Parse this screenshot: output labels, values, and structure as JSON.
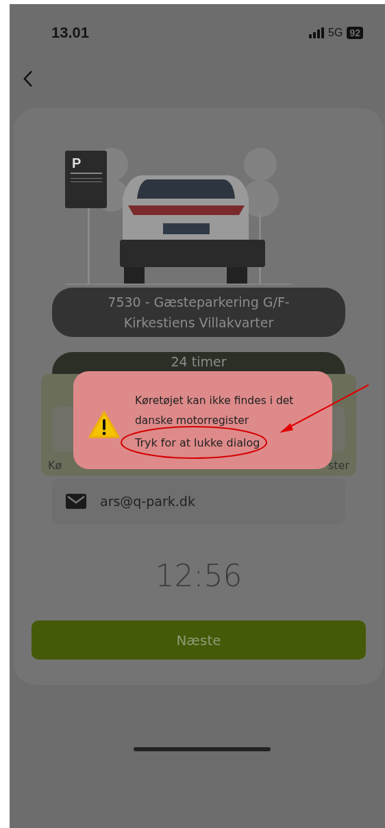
{
  "status_bar": {
    "time": "13.01",
    "network": "5G",
    "battery": "92"
  },
  "sign": "P",
  "location": "7530 - Gæsteparkering G/F-Kirkestiens Villakvarter",
  "duration": "24 timer",
  "hint": {
    "left": "Kø",
    "right": "ster"
  },
  "email": "ars@q-park.dk",
  "timer": "12:56",
  "next_button": "Næste",
  "dialog": {
    "message": "Køretøjet kan ikke findes i det danske motorregister",
    "close_link": "Tryk for at lukke dialog"
  }
}
